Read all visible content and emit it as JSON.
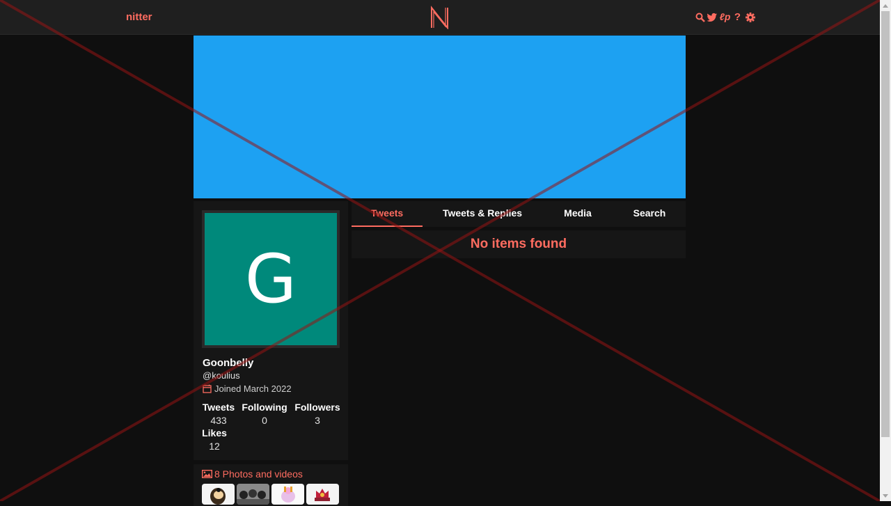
{
  "navbar": {
    "brand": "nitter",
    "logo_letter": "N",
    "icons": [
      "search-icon",
      "twitter-bird-icon",
      "lp-icon",
      "help-icon",
      "settings-gear-icon"
    ],
    "help_glyph": "?",
    "lp_glyph": "ℓp"
  },
  "profile": {
    "avatar_letter": "G",
    "fullname": "Goonbelly",
    "username": "@koulius",
    "joined": "Joined March 2022",
    "stats": [
      {
        "label": "Tweets",
        "value": "433"
      },
      {
        "label": "Following",
        "value": "0"
      },
      {
        "label": "Followers",
        "value": "3"
      },
      {
        "label": "Likes",
        "value": "12"
      }
    ]
  },
  "tabs": [
    {
      "label": "Tweets",
      "active": true
    },
    {
      "label": "Tweets & Replies",
      "active": false
    },
    {
      "label": "Media",
      "active": false
    },
    {
      "label": "Search",
      "active": false
    }
  ],
  "timeline": {
    "empty_message": "No items found"
  },
  "photo_rail": {
    "header": "8 Photos and videos"
  },
  "colors": {
    "accent": "#ff6c60",
    "banner": "#1da1f2",
    "avatar_bg": "#00897b",
    "background": "#0f0f0f",
    "panel": "#161616"
  }
}
